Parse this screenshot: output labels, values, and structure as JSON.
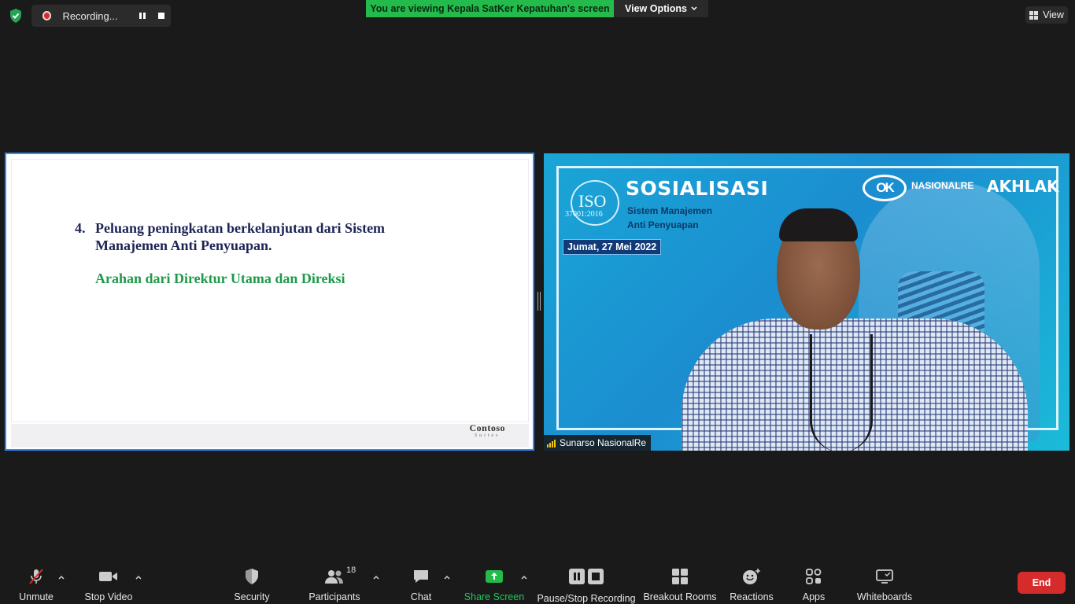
{
  "top": {
    "recording_label": "Recording...",
    "viewing_banner": "You are viewing Kepala SatKer Kepatuhan's screen",
    "view_options_label": "View Options",
    "view_label": "View"
  },
  "slide": {
    "item_number": "4.",
    "line1": "Peluang peningkatan berkelanjutan dari Sistem",
    "line2": "Manajemen Anti Penyuapan.",
    "green_line": "Arahan dari Direktur Utama dan Direksi",
    "footer_brand": "Contoso",
    "footer_brand_sub": "Suites"
  },
  "video": {
    "iso_label": "ISO",
    "iso_number": "37001:2016",
    "title": "SOSIALISASI",
    "subtitle_line1": "Sistem Manajemen",
    "subtitle_line2": "Anti Penyuapan",
    "date": "Jumat, 27 Mei 2022",
    "logo_ok": "OK",
    "logo_nasionalre": "NASIONALRE",
    "logo_akhlak": "AKHLAK",
    "participant_name": "Sunarso NasionalRe"
  },
  "toolbar": {
    "unmute": "Unmute",
    "stop_video": "Stop Video",
    "security": "Security",
    "participants": "Participants",
    "participants_count": "18",
    "chat": "Chat",
    "share_screen": "Share Screen",
    "pause_stop_recording": "Pause/Stop Recording",
    "breakout_rooms": "Breakout Rooms",
    "reactions": "Reactions",
    "apps": "Apps",
    "whiteboards": "Whiteboards",
    "end": "End"
  },
  "colors": {
    "share_green": "#22bb4c",
    "end_red": "#d52b2b",
    "active_border": "#2d8cff",
    "slide_title": "#1e2454",
    "slide_green": "#1f9a4a"
  },
  "icons": [
    "shield-check-icon",
    "record-icon",
    "pause-icon",
    "stop-icon",
    "chevron-down-icon",
    "grid-view-icon",
    "microphone-muted-icon",
    "video-camera-icon",
    "security-shield-icon",
    "participants-icon",
    "chat-bubble-icon",
    "share-screen-icon",
    "pause-recording-icon",
    "stop-recording-icon",
    "breakout-rooms-icon",
    "reactions-icon",
    "apps-icon",
    "whiteboard-icon",
    "signal-bars-icon"
  ]
}
